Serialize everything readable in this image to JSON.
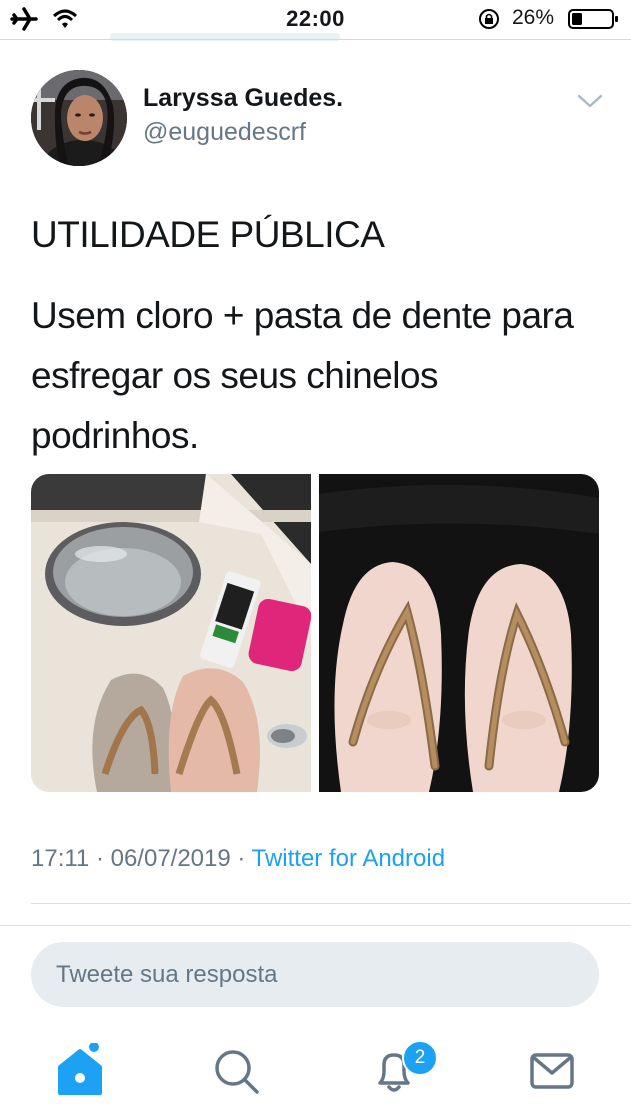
{
  "status_bar": {
    "time": "22:00",
    "battery_percent": "26%",
    "battery_level": 0.26,
    "icons": [
      "airplane-icon",
      "wifi-icon",
      "orientation-lock-icon",
      "battery-icon"
    ]
  },
  "tweet": {
    "display_name": "Laryssa Guedes.",
    "handle": "@euguedescrf",
    "heading": "UTILIDADE PÚBLICA",
    "body": "Usem cloro + pasta de dente para esfregar os seus chinelos podrinhos.",
    "timestamp": "17:11 · 06/07/2019 · ",
    "source": "Twitter for Android"
  },
  "reply": {
    "placeholder": "Tweete sua resposta"
  },
  "tab_bar": {
    "tabs": [
      "home-icon",
      "search-icon",
      "notifications-icon",
      "messages-icon"
    ],
    "notification_badge": "2"
  },
  "colors": {
    "accent": "#1da1f2",
    "secondary_text": "#657786",
    "reply_bg": "#e6ecf0"
  }
}
